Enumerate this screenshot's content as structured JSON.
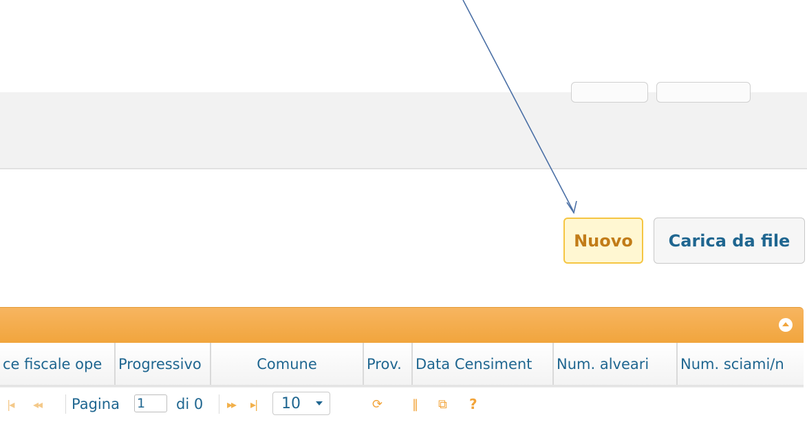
{
  "actions": {
    "new_label": "Nuovo",
    "upload_label": "Carica da file"
  },
  "grid": {
    "columns": [
      "ce fiscale ope",
      "Progressivo",
      "Comune",
      "Prov.",
      "Data Censiment",
      "Num. alveari",
      "Num. sciami/n"
    ],
    "pager": {
      "page_label": "Pagina",
      "page_value": "1",
      "of_label": "di 0",
      "page_size": "10"
    }
  },
  "icons": {
    "first": "first-page-icon",
    "prev": "prev-page-icon",
    "next": "next-page-icon",
    "last": "last-page-icon",
    "refresh": "refresh-icon",
    "columns": "columns-icon",
    "popout": "popout-icon",
    "help": "help-icon",
    "collapse": "collapse-icon"
  },
  "colors": {
    "accent_orange": "#f1a53d",
    "link_blue": "#1f6690",
    "new_button_bg": "#fff7d2",
    "annotation_arrow": "#4a6fa5"
  }
}
